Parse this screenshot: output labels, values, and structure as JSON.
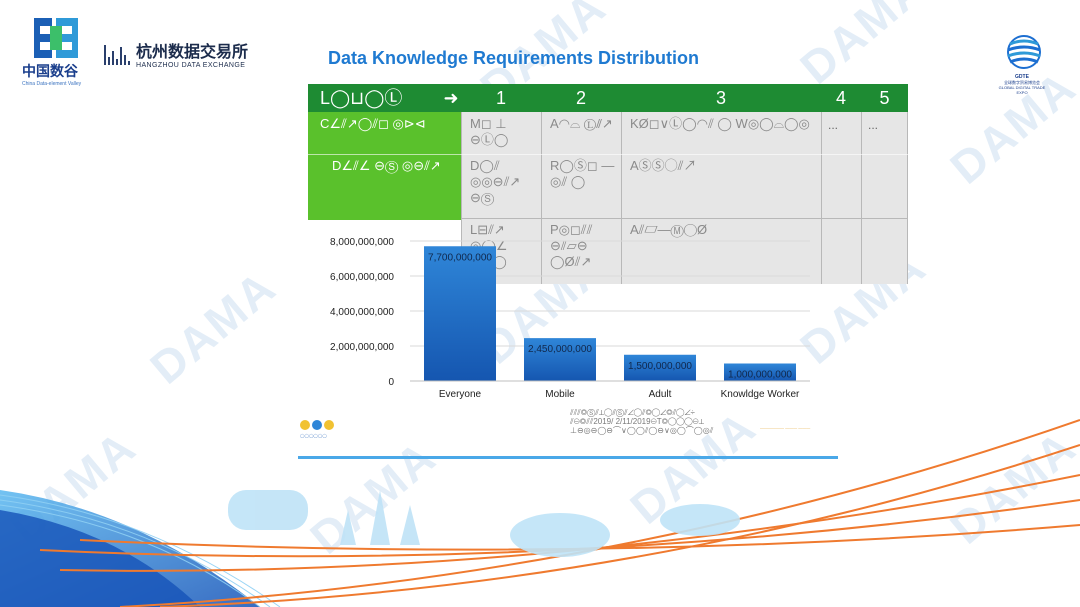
{
  "header": {
    "left_logo_cn": "中国数谷",
    "left_logo_en": "China Data-element Valley",
    "exchange_cn": "杭州数据交易所",
    "exchange_en": "HANGZHOU DATA EXCHANGE",
    "gdte_cn": "全球数字贸易博览会",
    "gdte_en": "GLOBAL DIGITAL TRADE EXPO",
    "gdte_short": "GDTE"
  },
  "title": "Data Knowledge Requirements Distribution",
  "watermark": "DAMA",
  "table": {
    "header_first": "L◯⊔◯Ⓛ",
    "arrow": "➜",
    "columns": [
      "1",
      "2",
      "3",
      "4",
      "5"
    ],
    "left_rows": [
      "C∠⫽↗◯⫽◻ ◎⊳⊲",
      "D∠⫽∠ ⊖Ⓢ ◎⊖⫽↗"
    ],
    "cells": {
      "r1c1": "M◻ ⊥ ⊖Ⓛ◯",
      "r1c2": "A◠⌓ Ⓛ⫽↗",
      "r1c3": "KØ◻∨Ⓛ◯◠⫽ ◯ W◎◯⌓◯◎",
      "r2c1": "D◯⫽ ◎◎⊖⫽↗ ⊖Ⓢ",
      "r2c2": "R◯Ⓢ◻ —◎⫽ ◯",
      "r2c3": "AⓈⓈ◯⫽↗",
      "r3c1": "L⊟⫽↗ ◎◯∠ ⊖◎◯",
      "r3c2": "P◎◻⫽⫽ ⊖⫽▱⊖ ◯Ø⫽↗",
      "r3c3": "A⫽▱—Ⓜ◯Ø",
      "c4": "...",
      "c5": "..."
    }
  },
  "chart_data": {
    "type": "bar",
    "categories": [
      "Everyone",
      "Mobile",
      "Adult",
      "Knowldge Worker"
    ],
    "values": [
      7700000000,
      2450000000,
      1500000000,
      1000000000
    ],
    "data_labels": [
      "7,700,000,000",
      "2,450,000,000",
      "1,500,000,000",
      "1,000,000,000"
    ],
    "yticks": [
      0,
      2000000000,
      4000000000,
      6000000000,
      8000000000
    ],
    "ytick_labels": [
      "0",
      "2,000,000,000",
      "4,000,000,000",
      "6,000,000,000",
      "8,000,000,000"
    ],
    "ylim": [
      0,
      8000000000
    ],
    "title": "",
    "xlabel": "",
    "ylabel": "",
    "bar_color_top": "#2f86d8",
    "bar_color_bottom": "#1556b0",
    "grid": true
  },
  "footer": {
    "note_lines": [
      "⫽⫽⫽◎Ⓢ⫽⊥◯⫽Ⓢ⫽∠◯⫽◎◯∠◎⫽◯∠÷",
      "⫽⊖◎⫽⫽2019/ 2/11/2019⊖T◎◯◯◯⊖⊥",
      "⊥⊖◎⊖◯⊖⌒∨◯◯⫽◯⊖∨◎◯⌒◯◎⫽"
    ],
    "icons_caption": "◯◯◯◯◯◯",
    "note_small": "—————— ——— ———"
  },
  "colors": {
    "title": "#1f7ad1",
    "table_header": "#1e8b33",
    "table_green": "#5ac12c",
    "table_grey": "#e6e6e6",
    "accent_line": "#4aa8e8",
    "orange_wave": "#ef7a2f",
    "blue_wave": "#1d6fd1"
  }
}
